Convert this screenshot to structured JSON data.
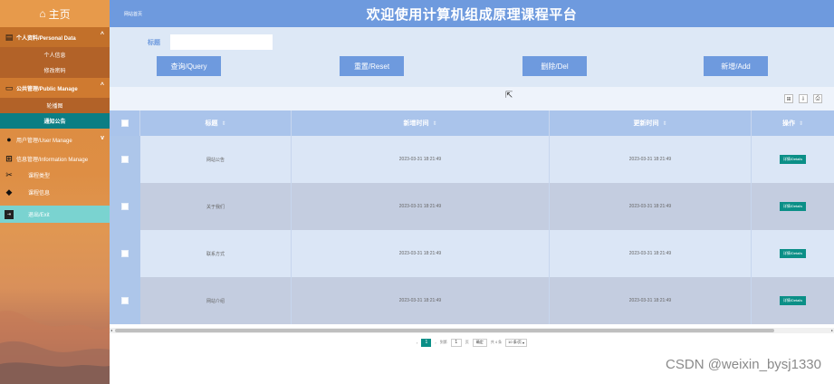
{
  "sidebar": {
    "home": "主页",
    "groups": {
      "personal": "个人资料/Personal Data",
      "public": "公共管理/Public Manage",
      "user": "用户管理/User Manage",
      "info": "信息管理/Information Manage"
    },
    "personal_items": [
      "个人信息",
      "修改密码"
    ],
    "public_items": [
      "轮播图",
      "通知公告"
    ],
    "info_items": [
      "课程类型",
      "课程信息"
    ],
    "exit": "退出/Exit"
  },
  "header": {
    "breadcrumb": "网站首页",
    "title": "欢迎使用计算机组成原理课程平台"
  },
  "search": {
    "label": "标题",
    "value": "",
    "buttons": {
      "query": "查询/Query",
      "reset": "重置/Reset",
      "del": "删除/Del",
      "add": "新增/Add"
    }
  },
  "table": {
    "columns": [
      "标题",
      "新增时间",
      "更新时间",
      "操作"
    ],
    "rows": [
      {
        "title": "网站公告",
        "created": "2023-03-31 18:21:49",
        "updated": "2023-03-31 18:21:49",
        "action": "详情/Details"
      },
      {
        "title": "关于我们",
        "created": "2023-03-31 18:21:49",
        "updated": "2023-03-31 18:21:49",
        "action": "详情/Details"
      },
      {
        "title": "联系方式",
        "created": "2023-03-31 18:21:49",
        "updated": "2023-03-31 18:21:49",
        "action": "详情/Details"
      },
      {
        "title": "网站介绍",
        "created": "2023-03-31 18:21:49",
        "updated": "2023-03-31 18:21:49",
        "action": "详情/Details"
      }
    ]
  },
  "pager": {
    "current": "1",
    "goto_label": "到第",
    "goto_value": "1",
    "page_unit": "页",
    "confirm": "确定",
    "total": "共 4 条",
    "per_page": "10 条/页"
  },
  "watermark": "CSDN @weixin_bysj1330"
}
